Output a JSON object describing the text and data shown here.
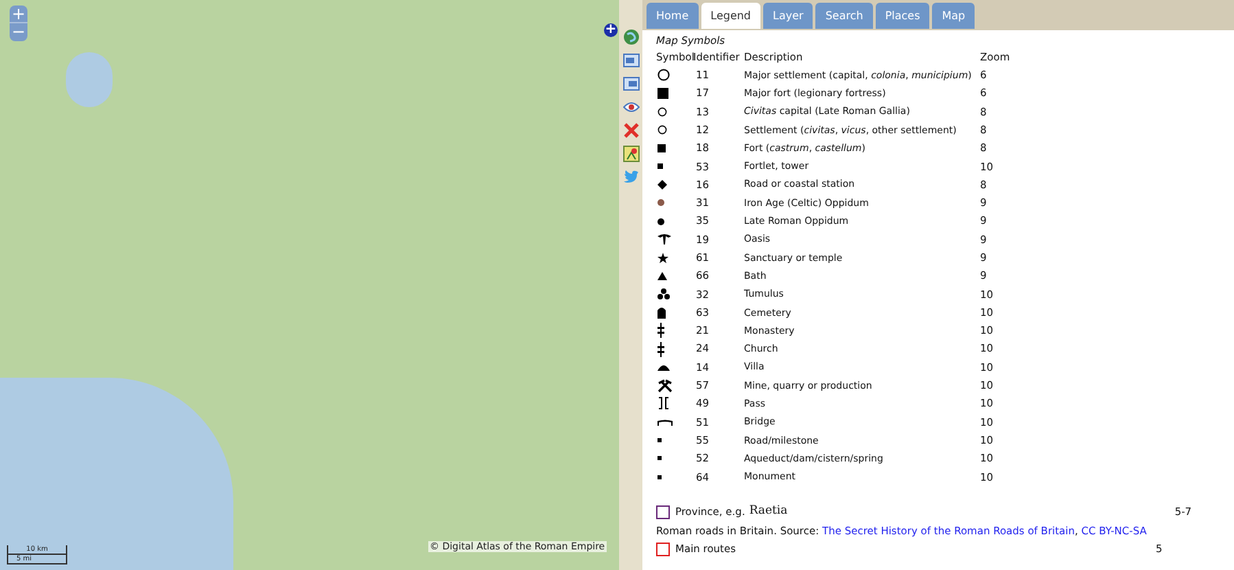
{
  "map": {
    "zoom_in": "+",
    "zoom_out": "−",
    "expand": "+",
    "scale_km": "10 km",
    "scale_mi": "5 mi",
    "attribution": "© Digital Atlas of the Roman Empire"
  },
  "tabs": [
    {
      "label": "Home",
      "selected": false
    },
    {
      "label": "Legend",
      "selected": true
    },
    {
      "label": "Layer",
      "selected": false
    },
    {
      "label": "Search",
      "selected": false
    },
    {
      "label": "Places",
      "selected": false
    },
    {
      "label": "Map",
      "selected": false
    }
  ],
  "legend": {
    "title": "Map Symbols",
    "columns": [
      "Symbol",
      "Identifier",
      "Description",
      "Zoom"
    ],
    "rows": [
      {
        "kind": "circle-large",
        "id": "11",
        "description": "Major settlement (capital, *colonia*, *municipium*)",
        "zoom": "6"
      },
      {
        "kind": "square-large",
        "id": "17",
        "description": "Major fort (legionary fortress)",
        "zoom": "6"
      },
      {
        "kind": "circle",
        "id": "13",
        "description": "*Civitas* capital (Late Roman Gallia)",
        "zoom": "8"
      },
      {
        "kind": "circle",
        "id": "12",
        "description": "Settlement (*civitas*, *vicus*, other settlement)",
        "zoom": "8"
      },
      {
        "kind": "square",
        "id": "18",
        "description": "Fort (*castrum*, *castellum*)",
        "zoom": "8"
      },
      {
        "kind": "square-small",
        "id": "53",
        "description": "Fortlet, tower",
        "zoom": "10"
      },
      {
        "kind": "diamond",
        "id": "16",
        "description": "Road or coastal station",
        "zoom": "8"
      },
      {
        "kind": "dot",
        "color": "#8b5a4a",
        "id": "31",
        "description": "Iron Age (Celtic) Oppidum",
        "zoom": "9"
      },
      {
        "kind": "dot",
        "color": "#000000",
        "id": "35",
        "description": "Late Roman Oppidum",
        "zoom": "9"
      },
      {
        "kind": "palm",
        "id": "19",
        "description": "Oasis",
        "zoom": "9"
      },
      {
        "kind": "star",
        "id": "61",
        "description": "Sanctuary or temple",
        "zoom": "9"
      },
      {
        "kind": "triangle",
        "id": "66",
        "description": "Bath",
        "zoom": "9"
      },
      {
        "kind": "tumulus",
        "id": "32",
        "description": "Tumulus",
        "zoom": "10"
      },
      {
        "kind": "tombstone",
        "id": "63",
        "description": "Cemetery",
        "zoom": "10"
      },
      {
        "kind": "cross",
        "id": "21",
        "description": "Monastery",
        "zoom": "10"
      },
      {
        "kind": "cross",
        "id": "24",
        "description": "Church",
        "zoom": "10"
      },
      {
        "kind": "dome",
        "id": "14",
        "description": "Villa",
        "zoom": "10"
      },
      {
        "kind": "pickaxe",
        "id": "57",
        "description": "Mine, quarry or production",
        "zoom": "10"
      },
      {
        "kind": "pass",
        "id": "49",
        "description": "Pass",
        "zoom": "10"
      },
      {
        "kind": "bridge",
        "id": "51",
        "description": "Bridge",
        "zoom": "10"
      },
      {
        "kind": "small-dot",
        "id": "55",
        "description": "Road/milestone",
        "zoom": "10"
      },
      {
        "kind": "small-dot",
        "id": "52",
        "description": "Aqueduct/dam/cistern/spring",
        "zoom": "10"
      },
      {
        "kind": "small-dot",
        "id": "64",
        "description": "Monument",
        "zoom": "10"
      }
    ]
  },
  "province": {
    "label": "Province, e.g.",
    "example": "Raetia",
    "zoom": "5-7"
  },
  "source": {
    "text": "Roman roads in Britain. Source:",
    "link": "The Secret History of the Roman Roads of Britain",
    "separator": ",",
    "license": "CC BY-NC-SA"
  },
  "routes": {
    "label": "Main routes",
    "zoom": "5"
  }
}
